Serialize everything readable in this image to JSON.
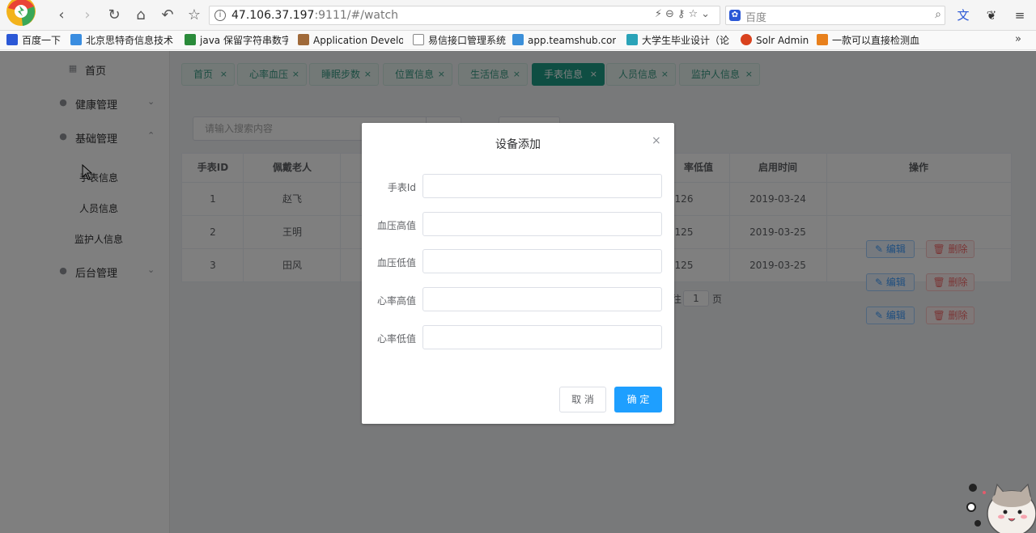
{
  "browser": {
    "url_host": "47.106.37.197",
    "url_rest": ":9111/#/watch",
    "search_engine": "百度",
    "bookmarks": [
      "百度一下",
      "北京思特奇信息技术",
      "java 保留字符串数字",
      "Application Develo",
      "易信接口管理系统",
      "app.teamshub.com",
      "大学生毕业设计（论",
      "Solr Admin",
      "一款可以直接检测血"
    ]
  },
  "sidebar": {
    "home": "首页",
    "health": "健康管理",
    "basic": "基础管理",
    "sub_items": [
      "手表信息",
      "人员信息",
      "监护人信息"
    ],
    "backend": "后台管理"
  },
  "tabs": [
    {
      "label": "首页",
      "active": false
    },
    {
      "label": "心率血压",
      "active": false
    },
    {
      "label": "睡眠步数",
      "active": false
    },
    {
      "label": "位置信息",
      "active": false
    },
    {
      "label": "生活信息",
      "active": false
    },
    {
      "label": "手表信息",
      "active": true
    },
    {
      "label": "人员信息",
      "active": false
    },
    {
      "label": "监护人信息",
      "active": false
    }
  ],
  "search": {
    "placeholder": "请输入搜索内容"
  },
  "table": {
    "headers": [
      "手表ID",
      "佩戴老人",
      "率低值",
      "启用时间",
      "操作"
    ],
    "rows": [
      {
        "id": "1",
        "name": "赵飞",
        "low": "126",
        "date": "2019-03-24"
      },
      {
        "id": "2",
        "name": "王明",
        "low": "125",
        "date": "2019-03-25"
      },
      {
        "id": "3",
        "name": "田风",
        "low": "125",
        "date": "2019-03-25"
      }
    ],
    "edit_label": "编辑",
    "delete_label": "删除"
  },
  "pager": {
    "prefix": "往",
    "page": "1",
    "suffix": "页"
  },
  "dialog": {
    "title": "设备添加",
    "fields": [
      "手表Id",
      "血压高值",
      "血压低值",
      "心率高值",
      "心率低值"
    ],
    "cancel": "取 消",
    "confirm": "确 定"
  },
  "colors": {
    "accent": "#1f9c86",
    "primary": "#1e9fff"
  }
}
